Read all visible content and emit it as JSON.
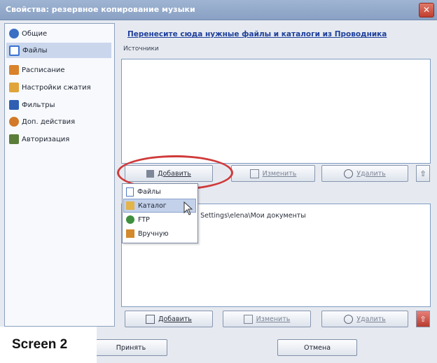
{
  "window": {
    "title": "Свойства: резервное копирование музыки",
    "close_icon": "close-icon"
  },
  "sidebar": {
    "items": [
      {
        "label": "Общие",
        "icon": "general-icon",
        "color": "#3b6fc4"
      },
      {
        "label": "Файлы",
        "icon": "files-icon",
        "color": "#3a72d0",
        "active": true
      },
      {
        "label": "Расписание",
        "icon": "schedule-icon",
        "color": "#d9822b"
      },
      {
        "label": "Настройки сжатия",
        "icon": "compression-icon",
        "color": "#e0a43a"
      },
      {
        "label": "Фильтры",
        "icon": "filter-icon",
        "color": "#2f5fb3"
      },
      {
        "label": "Доп. действия",
        "icon": "actions-icon",
        "color": "#d27a2a"
      },
      {
        "label": "Авторизация",
        "icon": "auth-icon",
        "color": "#5b7d3a"
      }
    ]
  },
  "main": {
    "banner": "Перенесите сюда нужные файлы и каталоги из Проводника",
    "sources_label": "Источники",
    "top_buttons": {
      "add": "Добавить",
      "change": "Изменить",
      "delete": "Удалить"
    },
    "bottom_path": "nd Settings\\elena\\Мои документы",
    "bottom_buttons": {
      "add": "Добавить",
      "change": "Изменить",
      "delete": "Удалить"
    }
  },
  "add_menu": {
    "items": [
      {
        "label": "Файлы",
        "icon": "file-icon"
      },
      {
        "label": "Каталог",
        "icon": "folder-icon",
        "hover": true
      },
      {
        "label": "FTP",
        "icon": "ftp-icon"
      },
      {
        "label": "Вручную",
        "icon": "manual-icon"
      }
    ]
  },
  "footer": {
    "apply": "Принять",
    "cancel": "Отмена"
  },
  "overlay": {
    "screen_label": "Screen 2"
  },
  "colors": {
    "highlight": "#d03a3a",
    "banner_link": "#1e3f9c",
    "active_nav": "#c9d6ec"
  }
}
